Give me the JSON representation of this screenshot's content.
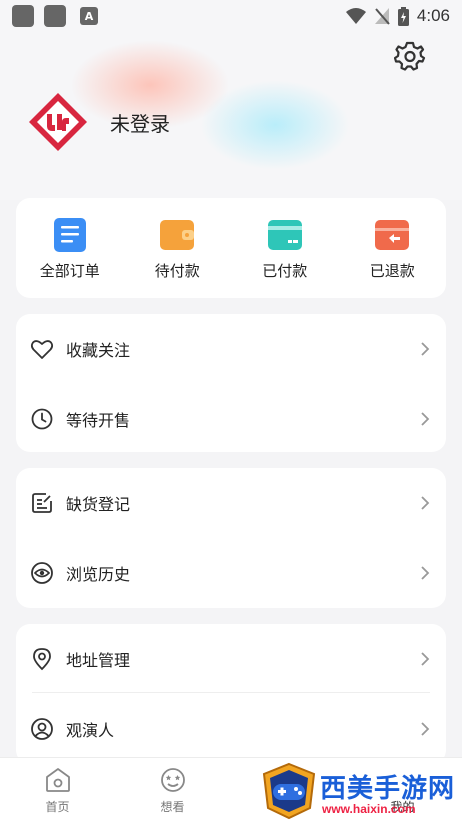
{
  "status_bar": {
    "time": "4:06",
    "app_icon_letter": "A"
  },
  "header": {
    "login_text": "未登录"
  },
  "orders": [
    {
      "label": "全部订单",
      "icon": "list-icon",
      "color": "#3b8ef5"
    },
    {
      "label": "待付款",
      "icon": "wallet-icon",
      "color": "#f5a23b"
    },
    {
      "label": "已付款",
      "icon": "card-icon",
      "color": "#2ec6b8"
    },
    {
      "label": "已退款",
      "icon": "refund-icon",
      "color": "#f06a4b"
    }
  ],
  "group1": [
    {
      "label": "收藏关注",
      "icon": "heart-icon"
    },
    {
      "label": "等待开售",
      "icon": "clock-icon"
    }
  ],
  "group2": [
    {
      "label": "缺货登记",
      "icon": "note-icon"
    },
    {
      "label": "浏览历史",
      "icon": "eye-icon"
    }
  ],
  "group3": [
    {
      "label": "地址管理",
      "icon": "location-icon"
    },
    {
      "label": "观演人",
      "icon": "person-icon"
    }
  ],
  "tabbar": [
    {
      "label": "首页",
      "icon": "home-icon"
    },
    {
      "label": "想看",
      "icon": "star-face-icon"
    },
    {
      "label": "",
      "icon": ""
    },
    {
      "label": "我的",
      "icon": "profile-icon"
    }
  ],
  "watermark": {
    "text": "西美手游网",
    "url": "www.haixin.com"
  }
}
